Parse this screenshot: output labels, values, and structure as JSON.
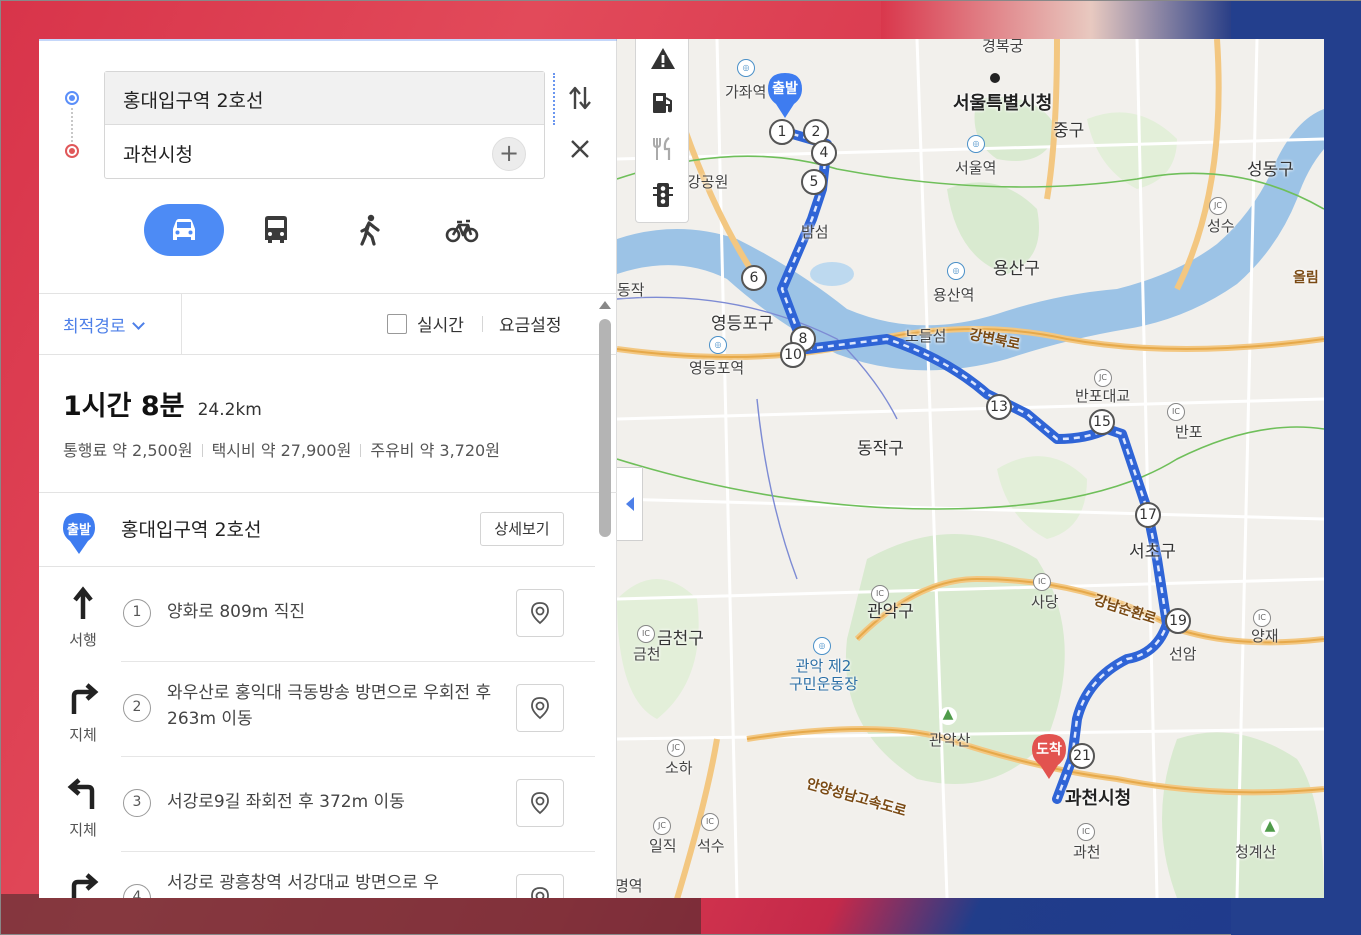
{
  "search": {
    "origin": "홍대입구역 2호선",
    "destination": "과천시청",
    "add_label": "+"
  },
  "modes": [
    {
      "name": "car",
      "active": true
    },
    {
      "name": "bus",
      "active": false
    },
    {
      "name": "walk",
      "active": false
    },
    {
      "name": "bike",
      "active": false
    }
  ],
  "options": {
    "route_type": "최적경로",
    "realtime_label": "실시간",
    "fare_label": "요금설정",
    "realtime_checked": false
  },
  "summary": {
    "time": "1시간 8분",
    "distance": "24.2km",
    "toll": "통행료 약 2,500원",
    "taxi": "택시비 약 27,900원",
    "fuel": "주유비 약 3,720원"
  },
  "start": {
    "badge": "출발",
    "name": "홍대입구역 2호선",
    "detail_label": "상세보기"
  },
  "steps": [
    {
      "num": "1",
      "text": "양화로 809m 직진",
      "tag": "서행",
      "icon": "straight-arrow-icon"
    },
    {
      "num": "2",
      "text": "와우산로 홍익대 극동방송 방면으로 우회전 후 263m 이동",
      "tag": "지체",
      "icon": "right-turn-arrow-icon"
    },
    {
      "num": "3",
      "text": "서강로9길 좌회전 후 372m 이동",
      "tag": "지체",
      "icon": "left-turn-arrow-icon"
    },
    {
      "num": "4",
      "text": "서강로 광흥창역 서강대교 방면으로 우",
      "tag": "",
      "icon": "right-turn-arrow-icon"
    }
  ],
  "map": {
    "start_badge": "출발",
    "end_badge": "도착",
    "labels": {
      "gyeongbokgung": "경복궁",
      "seoul_cityhall": "서울특별시청",
      "jung_gu": "중구",
      "seoul_station": "서울역",
      "seongdong_gu": "성동구",
      "seongsu": "성수",
      "gajwa": "가좌역",
      "gangbyeon_park": "강공원",
      "bamseom": "밤섬",
      "yongsan_gu": "용산구",
      "yongsan_station": "용산역",
      "olympic_road": "올림",
      "dongjak_road": "동작",
      "yeongdeungpo_gu": "영등포구",
      "yeongdeungpo_station": "영등포역",
      "nodeulseom": "노들섬",
      "gangbyeon_bukro": "강변북로",
      "banpo_bridge": "반포대교",
      "banpo": "반포",
      "dongjak_gu": "동작구",
      "seocho_gu": "서초구",
      "sadang": "사당",
      "gangnam_sunhwan": "강남순환로",
      "gwanak_gu": "관악구",
      "geumcheon_gu": "금천구",
      "geumcheon": "금천",
      "gwanak_stadium": "관악 제2\n구민운동장",
      "gwanaksan": "관악산",
      "seonam": "선암",
      "yangjae": "양재",
      "soha": "소하",
      "iljik": "일직",
      "seoksu": "석수",
      "anyang_expressway": "안양성남고속도로",
      "gwacheon_cityhall": "과천시청",
      "gwacheon": "과천",
      "cheonggyesan": "청계산",
      "myeongyeok": "명역",
      "dongjak_small": "동작"
    },
    "waypoints": [
      "1",
      "2",
      "4",
      "5",
      "6",
      "8",
      "10",
      "13",
      "15",
      "17",
      "19",
      "21"
    ]
  },
  "colors": {
    "accent": "#4d8bf5",
    "route": "#3d72e8",
    "start_marker": "#3e7cf0",
    "end_marker": "#e2534f",
    "river": "#9cc3e6",
    "park": "#d9ead0"
  }
}
